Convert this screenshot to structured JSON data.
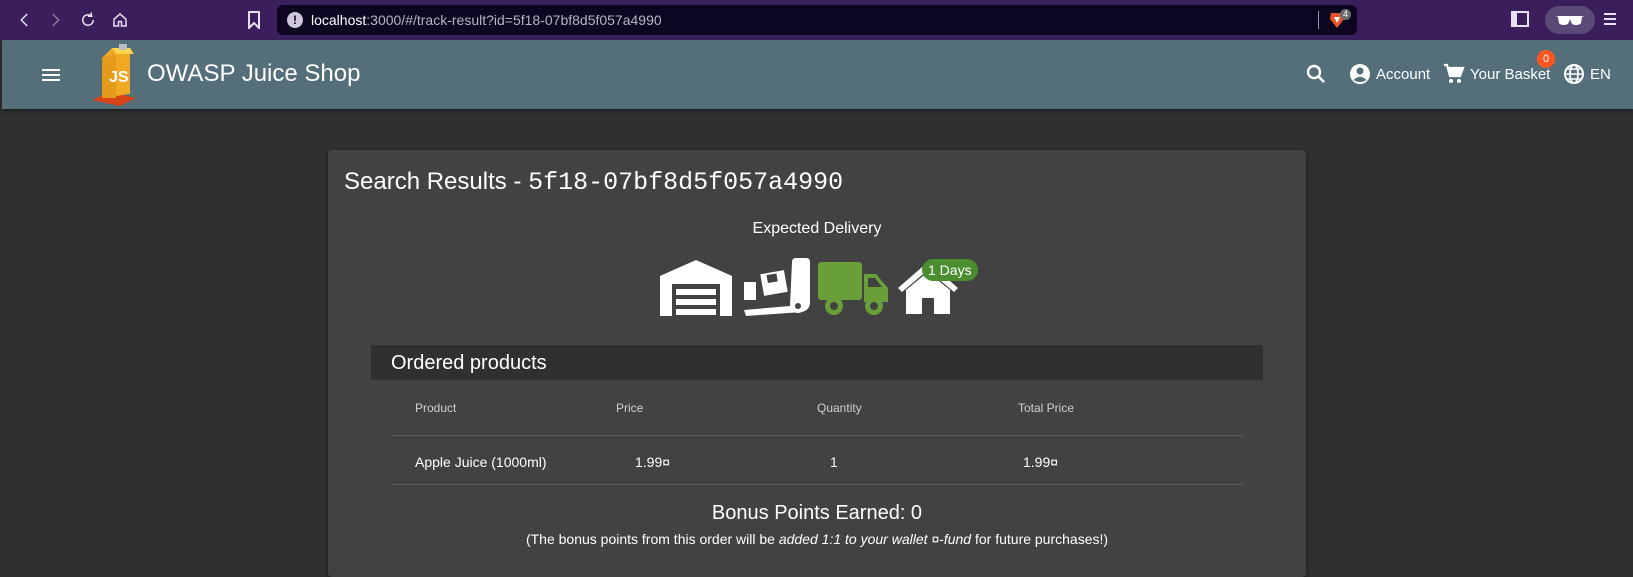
{
  "browser": {
    "url_host": "localhost",
    "url_rest": ":3000/#/track-result?id=5f18-07bf8d5f057a4990",
    "shield_count": "4"
  },
  "app": {
    "title": "OWASP Juice Shop",
    "account_label": "Account",
    "basket_label": "Your Basket",
    "basket_count": "0",
    "language": "EN"
  },
  "result": {
    "title_prefix": "Search Results - ",
    "order_id": "5f18-07bf8d5f057a4990",
    "expected_delivery": "Expected Delivery",
    "days_badge": "1 Days",
    "active_stage": "truck"
  },
  "products": {
    "title": "Ordered products",
    "columns": [
      "Product",
      "Price",
      "Quantity",
      "Total Price"
    ],
    "rows": [
      {
        "product": "Apple Juice (1000ml)",
        "price": "1.99¤",
        "quantity": "1",
        "total": "1.99¤"
      }
    ]
  },
  "bonus": {
    "heading": "Bonus Points Earned: 0",
    "note_prefix": "(The bonus points from this order will be ",
    "note_emph": "added 1:1 to your wallet ¤-fund",
    "note_suffix": " for future purchases!)"
  },
  "colors": {
    "toolbar": "#546e7a",
    "active_stage": "#689f38",
    "badge": "#ff5722"
  }
}
